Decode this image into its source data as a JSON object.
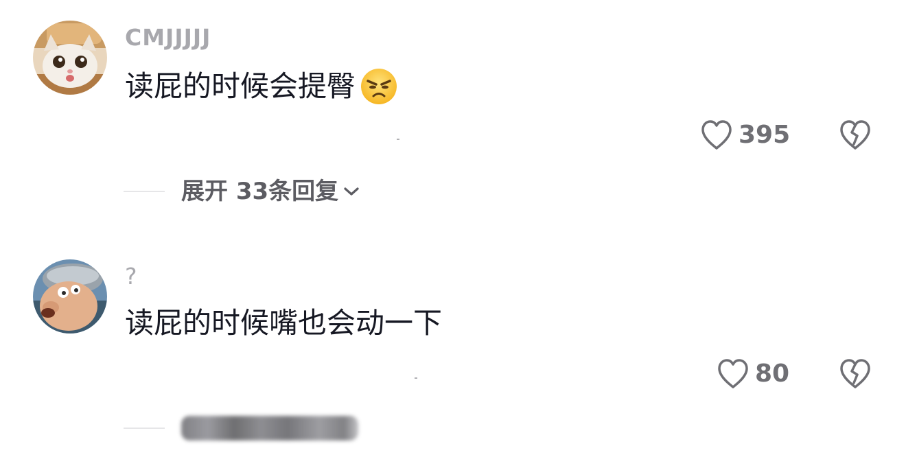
{
  "comments": [
    {
      "username": "CMJJJJJ",
      "text": "读屁的时候会提臀",
      "emoji": "angry-frown-emoji",
      "likes": "395",
      "replies_label": "展开 33条回复"
    },
    {
      "username": "?",
      "text": "读屁的时候嘴也会动一下",
      "likes": "80"
    }
  ],
  "icons": {
    "like": "heart-outline-icon",
    "dislike": "broken-heart-icon",
    "expand": "chevron-down-icon"
  },
  "colors": {
    "username": "#a8a8ad",
    "text": "#161823",
    "meta": "#6f6f74"
  }
}
